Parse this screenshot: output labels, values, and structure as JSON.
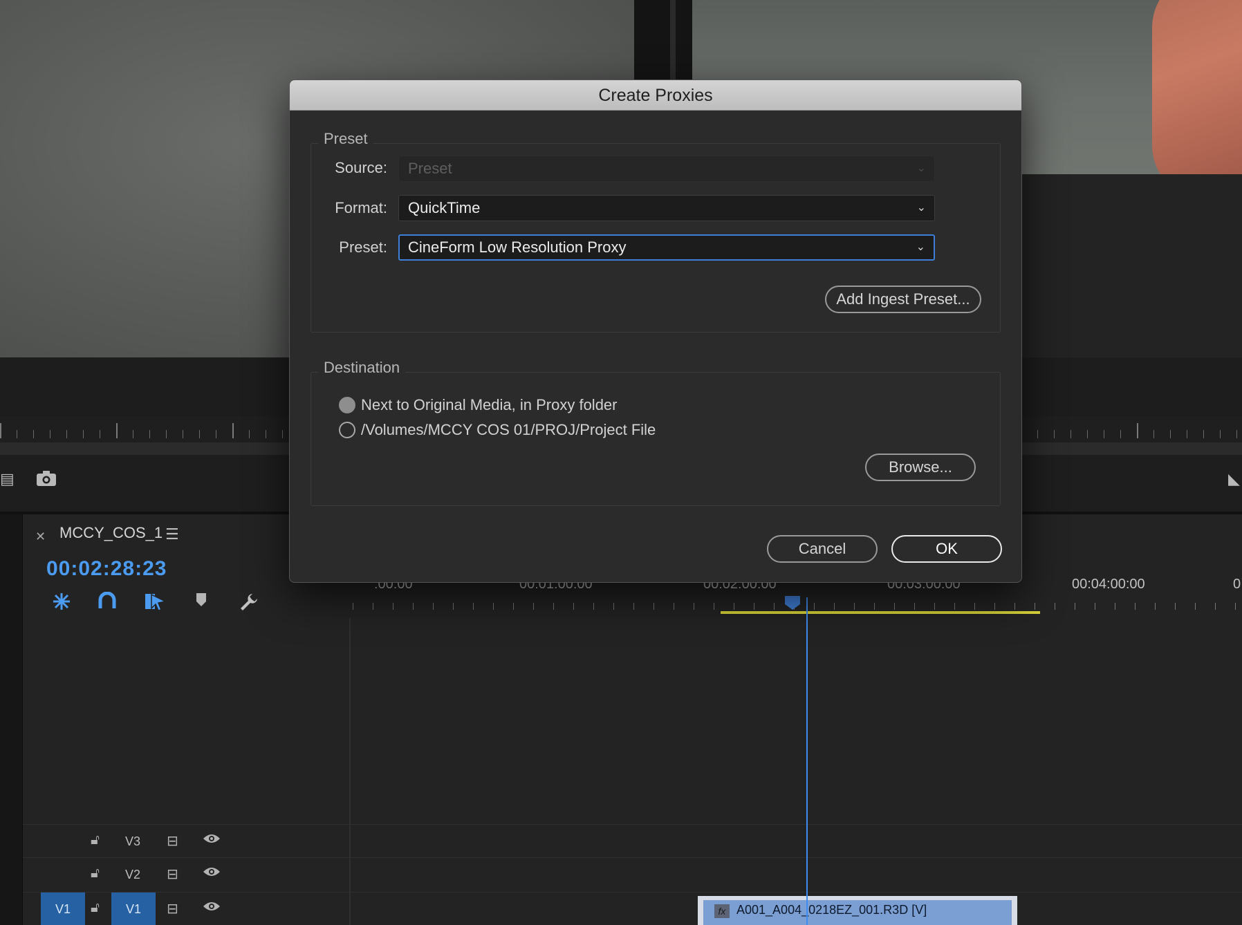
{
  "dialog": {
    "title": "Create Proxies",
    "preset_group": {
      "legend": "Preset",
      "source_label": "Source:",
      "source_value": "Preset",
      "format_label": "Format:",
      "format_value": "QuickTime",
      "preset_label": "Preset:",
      "preset_value": "CineForm Low Resolution Proxy",
      "add_ingest_preset": "Add Ingest Preset..."
    },
    "destination_group": {
      "legend": "Destination",
      "option_1": "Next to Original Media, in Proxy folder",
      "option_2": "/Volumes/MCCY COS 01/PROJ/Project File",
      "selected": "option_1",
      "browse": "Browse..."
    },
    "cancel": "Cancel",
    "ok": "OK"
  },
  "timeline": {
    "sequence_name": "MCCY_COS_1",
    "timecode": "00:02:28:23",
    "ruler_labels": [
      ":00:00",
      "00:01:00:00",
      "00:02:00:00",
      "00:03:00:00",
      "00:04:00:00",
      "0"
    ],
    "tracks": [
      {
        "name": "V3"
      },
      {
        "name": "V2"
      },
      {
        "name": "V1",
        "source": "V1"
      }
    ],
    "clip_name": "A001_A004_0218EZ_001.R3D [V]"
  },
  "colors": {
    "accent_blue": "#4b9bf0",
    "work_area_yellow": "#d7d33a",
    "clip_blue": "#7b9ed3"
  }
}
